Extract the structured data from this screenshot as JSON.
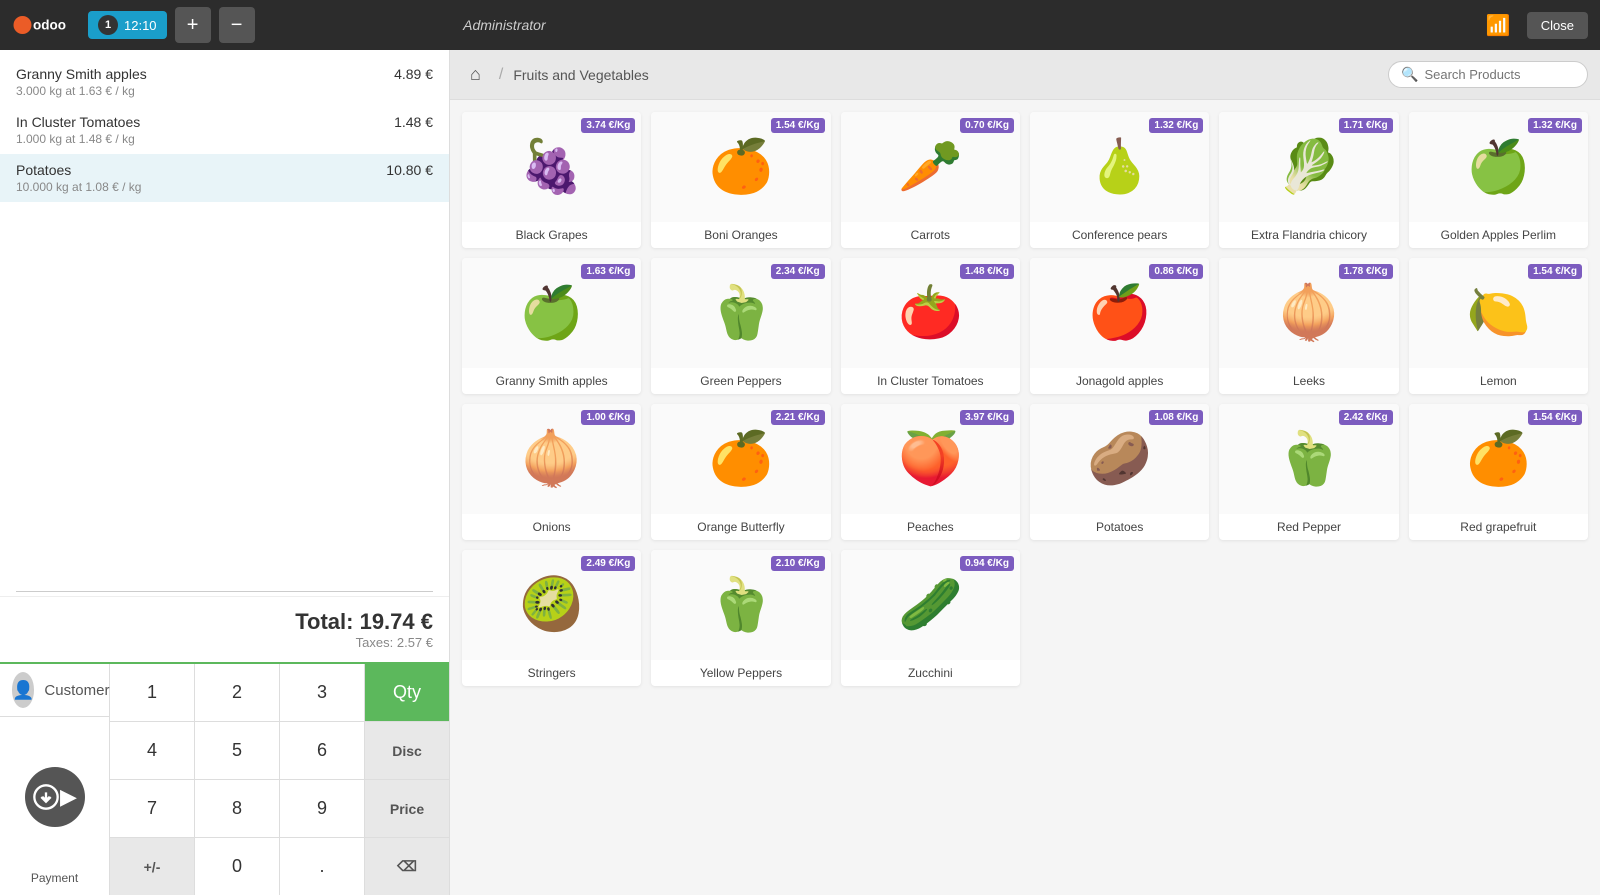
{
  "topbar": {
    "logo_text": "odoo",
    "admin_label": "Administrator",
    "order_num": "1",
    "order_time": "12:10",
    "add_btn": "+",
    "remove_btn": "−",
    "close_label": "Close"
  },
  "breadcrumb": {
    "home_icon": "⌂",
    "category": "Fruits and Vegetables",
    "search_placeholder": "Search Products"
  },
  "order": {
    "lines": [
      {
        "name": "Granny Smith apples",
        "detail": "3.000 kg at 1.63 € / kg",
        "price": "4.89 €",
        "selected": false
      },
      {
        "name": "In Cluster Tomatoes",
        "detail": "1.000 kg at 1.48 € / kg",
        "price": "1.48 €",
        "selected": false
      },
      {
        "name": "Potatoes",
        "detail": "10.000 kg at 1.08 € / kg",
        "price": "10.80 €",
        "selected": true
      }
    ],
    "total_label": "Total: 19.74 €",
    "tax_label": "Taxes: 2.57 €"
  },
  "numpad": {
    "customer_label": "Customer",
    "keys": [
      "1",
      "2",
      "3",
      "4",
      "5",
      "6",
      "7",
      "8",
      "9",
      "+/-",
      "0",
      "."
    ],
    "qty_label": "Qty",
    "disc_label": "Disc",
    "price_label": "Price",
    "backspace": "⌫",
    "payment_label": "Payment"
  },
  "products": [
    {
      "name": "Black Grapes",
      "price": "3.74 €/Kg",
      "emoji": "🍇"
    },
    {
      "name": "Boni Oranges",
      "price": "1.54 €/Kg",
      "emoji": "🍊"
    },
    {
      "name": "Carrots",
      "price": "0.70 €/Kg",
      "emoji": "🥕"
    },
    {
      "name": "Conference pears",
      "price": "1.32 €/Kg",
      "emoji": "🍐"
    },
    {
      "name": "Extra Flandria chicory",
      "price": "1.71 €/Kg",
      "emoji": "🥬"
    },
    {
      "name": "Golden Apples Perlim",
      "price": "1.32 €/Kg",
      "emoji": "🍏"
    },
    {
      "name": "Granny Smith apples",
      "price": "1.63 €/Kg",
      "emoji": "🍏"
    },
    {
      "name": "Green Peppers",
      "price": "2.34 €/Kg",
      "emoji": "🫑"
    },
    {
      "name": "In Cluster Tomatoes",
      "price": "1.48 €/Kg",
      "emoji": "🍅"
    },
    {
      "name": "Jonagold apples",
      "price": "0.86 €/Kg",
      "emoji": "🍎"
    },
    {
      "name": "Leeks",
      "price": "1.78 €/Kg",
      "emoji": "🧅"
    },
    {
      "name": "Lemon",
      "price": "1.54 €/Kg",
      "emoji": "🍋"
    },
    {
      "name": "Onions",
      "price": "1.00 €/Kg",
      "emoji": "🧅"
    },
    {
      "name": "Orange Butterfly",
      "price": "2.21 €/Kg",
      "emoji": "🍊"
    },
    {
      "name": "Peaches",
      "price": "3.97 €/Kg",
      "emoji": "🍑"
    },
    {
      "name": "Potatoes",
      "price": "1.08 €/Kg",
      "emoji": "🥔"
    },
    {
      "name": "Red Pepper",
      "price": "2.42 €/Kg",
      "emoji": "🫑"
    },
    {
      "name": "Red grapefruit",
      "price": "1.54 €/Kg",
      "emoji": "🍊"
    },
    {
      "name": "Stringers",
      "price": "2.49 €/Kg",
      "emoji": "🥝"
    },
    {
      "name": "Yellow Peppers",
      "price": "2.10 €/Kg",
      "emoji": "🫑"
    },
    {
      "name": "Zucchini",
      "price": "0.94 €/Kg",
      "emoji": "🥒"
    }
  ]
}
